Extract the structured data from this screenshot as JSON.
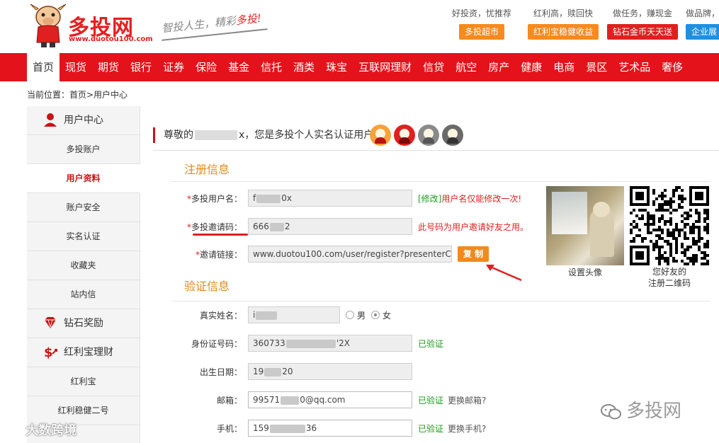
{
  "header": {
    "brand": "多投网",
    "brand_url": "www.duotou100.com",
    "slogan_pre": "智投人生，精彩",
    "slogan_hl": "多投!",
    "promos": [
      {
        "text": "好投资，忧推荐",
        "button": "多投超市",
        "color": "orange"
      },
      {
        "text": "红利高，赎回快",
        "button": "红利宝稳健收益",
        "color": "orange"
      },
      {
        "text": "做任务，赚现金",
        "button": "钻石金币天天送",
        "color": "red"
      },
      {
        "text": "做品牌，",
        "button": "企业展",
        "color": "blue"
      }
    ]
  },
  "nav": {
    "items": [
      "首页",
      "现货",
      "期货",
      "银行",
      "证券",
      "保险",
      "基金",
      "信托",
      "酒类",
      "珠宝",
      "互联网理财",
      "信贷",
      "航空",
      "房产",
      "健康",
      "电商",
      "景区",
      "艺术品",
      "奢侈"
    ],
    "active_index": 0
  },
  "breadcrumb": "当前位置：首页>用户中心",
  "sidebar": {
    "items": [
      {
        "label": "用户中心",
        "type": "head",
        "icon": "user-icon"
      },
      {
        "label": "多投账户",
        "type": "sub"
      },
      {
        "label": "用户资料",
        "type": "active"
      },
      {
        "label": "账户安全",
        "type": "sub"
      },
      {
        "label": "实名认证",
        "type": "sub"
      },
      {
        "label": "收藏夹",
        "type": "sub"
      },
      {
        "label": "站内信",
        "type": "sub"
      },
      {
        "label": "钻石奖励",
        "type": "head",
        "icon": "diamond-icon"
      },
      {
        "label": "红利宝理财",
        "type": "head",
        "icon": "money-icon"
      },
      {
        "label": "红利宝",
        "type": "sub"
      },
      {
        "label": "红利稳健二号",
        "type": "sub"
      }
    ]
  },
  "welcome": {
    "prefix": "尊敬的",
    "user_tail": "x",
    "suffix": "，您是多投个人实名认证用户"
  },
  "register": {
    "title": "注册信息",
    "username_label": "多投用户名：",
    "username_start": "f",
    "username_end": "0x",
    "modify_link": "[修改]",
    "username_note": "用户名仅能修改一次!",
    "invite_code_label": "多投邀请码：",
    "invite_code_start": "666",
    "invite_code_end": "2",
    "invite_code_note": "此号码为用户邀请好友之用。",
    "invite_link_label": "邀请链接：",
    "invite_link_value": "www.duotou100.com/user/register?presenterC",
    "copy_button": "复 制",
    "avatar_caption": "设置头像",
    "qr_caption_1": "您好友的",
    "qr_caption_2": "注册二维码"
  },
  "verify": {
    "title": "验证信息",
    "name_label": "真实姓名：",
    "name_value": "i",
    "gender_male": "男",
    "gender_female": "女",
    "id_label": "身份证号码：",
    "id_start": "360733",
    "id_end": "'2X",
    "id_status": "已验证",
    "birth_label": "出生日期：",
    "birth_start": "19",
    "birth_end": "20",
    "email_label": "邮箱：",
    "email_start": "99571",
    "email_end": "0@qq.com",
    "email_status": "已验证",
    "email_change": "更换邮箱?",
    "phone_label": "手机：",
    "phone_start": "159",
    "phone_end": "36",
    "phone_status": "已验证",
    "phone_change": "更换手机?"
  },
  "watermarks": {
    "left": "大数跨境",
    "right": "多投网"
  },
  "colors": {
    "brand_red": "#e4121b",
    "accent_orange": "#f08a1e",
    "verified_green": "#1c9a1c"
  }
}
